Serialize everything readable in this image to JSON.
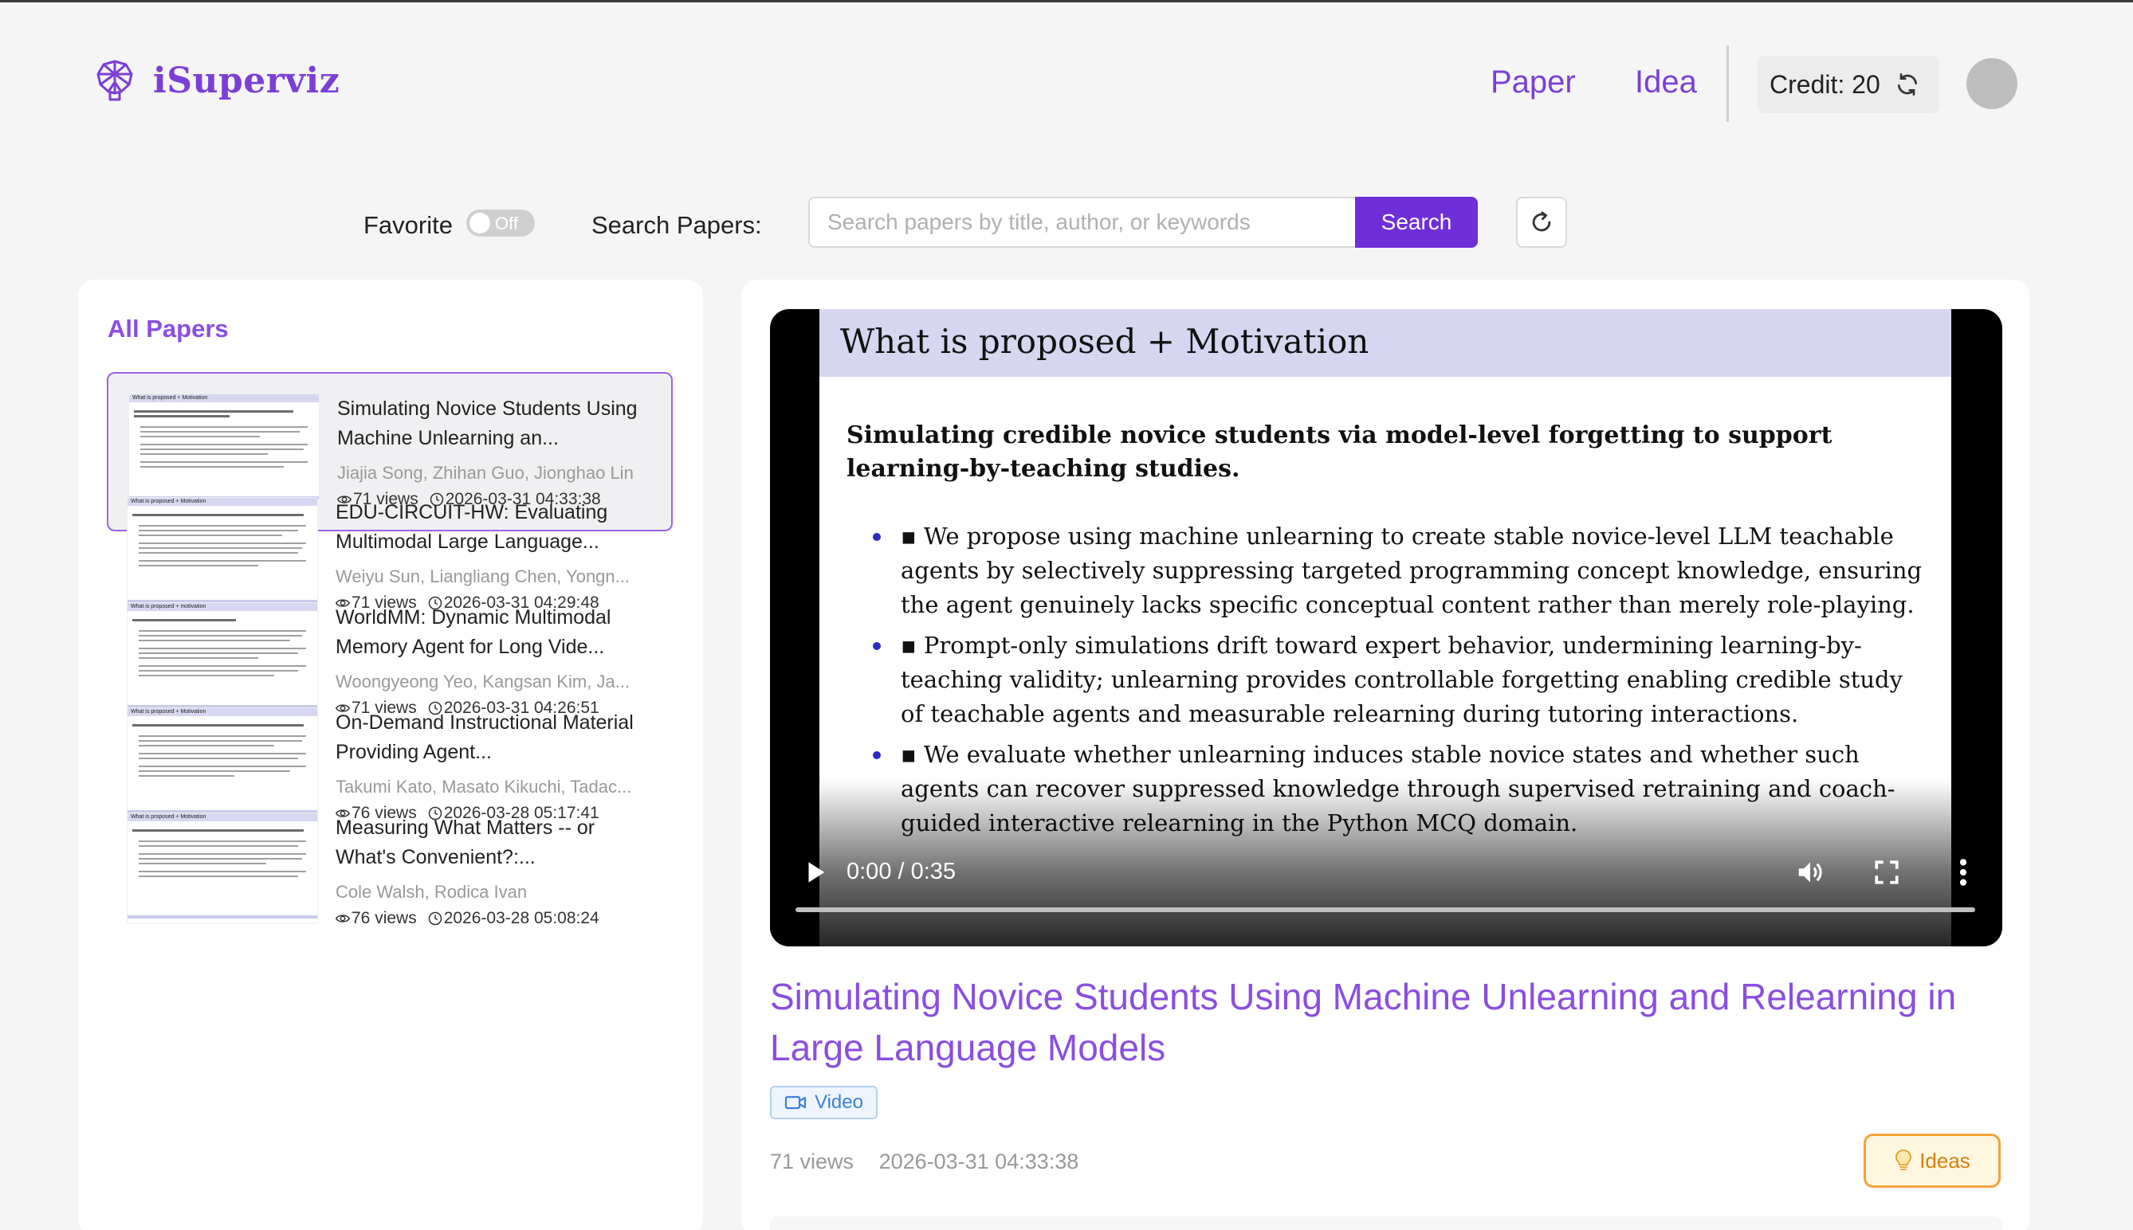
{
  "header": {
    "logo_text": "iSuperviz",
    "nav": {
      "paper": "Paper",
      "idea": "Idea"
    },
    "credit_label": "Credit: 20"
  },
  "toolbar": {
    "favorite_label": "Favorite",
    "favorite_state": "Off",
    "search_label": "Search Papers:",
    "search_placeholder": "Search papers by title, author, or keywords",
    "search_value": "",
    "search_button": "Search"
  },
  "sidebar": {
    "heading": "All Papers",
    "papers": [
      {
        "thumb_title": "What is proposed + Motivation",
        "title": "Simulating Novice Students Using Machine Unlearning an...",
        "authors": "Jiajia Song, Zhihan Guo, Jionghao Lin",
        "views": "71 views",
        "date": "2026-03-31 04:33:38"
      },
      {
        "thumb_title": "What is proposed + Motivation",
        "title": "EDU-CIRCUIT-HW: Evaluating Multimodal Large Language...",
        "authors": "Weiyu Sun, Liangliang Chen, Yongn...",
        "views": "71 views",
        "date": "2026-03-31 04:29:48"
      },
      {
        "thumb_title": "What is proposed + motivation",
        "title": "WorldMM: Dynamic Multimodal Memory Agent for Long Vide...",
        "authors": "Woongyeong Yeo, Kangsan Kim, Ja...",
        "views": "71 views",
        "date": "2026-03-31 04:26:51"
      },
      {
        "thumb_title": "What is proposed + Motivation",
        "title": "On-Demand Instructional Material Providing Agent...",
        "authors": "Takumi Kato, Masato Kikuchi, Tadac...",
        "views": "76 views",
        "date": "2026-03-28 05:17:41"
      },
      {
        "thumb_title": "What is proposed + Motivation",
        "title": "Measuring What Matters -- or What's Convenient?:...",
        "authors": "Cole Walsh, Rodica Ivan",
        "views": "76 views",
        "date": "2026-03-28 05:08:24"
      }
    ]
  },
  "main": {
    "slide": {
      "title": "What is proposed + Motivation",
      "subtitle": "Simulating credible novice students via model-level forgetting to support learning-by-teaching studies.",
      "bullets": [
        "▪ We propose using machine unlearning to create stable novice-level LLM teachable agents by selectively suppressing targeted programming concept knowledge, ensuring the agent genuinely lacks specific conceptual content rather than merely role-playing.",
        "▪ Prompt-only simulations drift toward expert behavior, undermining learning-by-teaching validity; unlearning provides controllable forgetting enabling credible study of teachable agents and measurable relearning during tutoring interactions.",
        "▪ We evaluate whether unlearning induces stable novice states and whether such agents can recover suppressed knowledge through supervised retraining and coach-guided interactive relearning in the Python MCQ domain."
      ]
    },
    "video_time": "0:00 / 0:35",
    "video_progress": 0,
    "paper_title": "Simulating Novice Students Using Machine Unlearning and Relearning in Large Language Models",
    "badge": "Video",
    "views": "71 views",
    "date": "2026-03-31 04:33:38",
    "ideas_button": "Ideas"
  },
  "colors": {
    "accent": "#7b3fd6",
    "accent_light": "#8a4ee0",
    "search_button": "#6f2fd8",
    "ideas_border": "#f4a23a",
    "video_badge": "#3d7fd6"
  },
  "icons": [
    "brain-logo-icon",
    "refresh-icon",
    "eye-icon",
    "clock-icon",
    "play-icon",
    "volume-icon",
    "fullscreen-icon",
    "more-vert-icon",
    "video-camera-icon",
    "lightbulb-icon"
  ]
}
